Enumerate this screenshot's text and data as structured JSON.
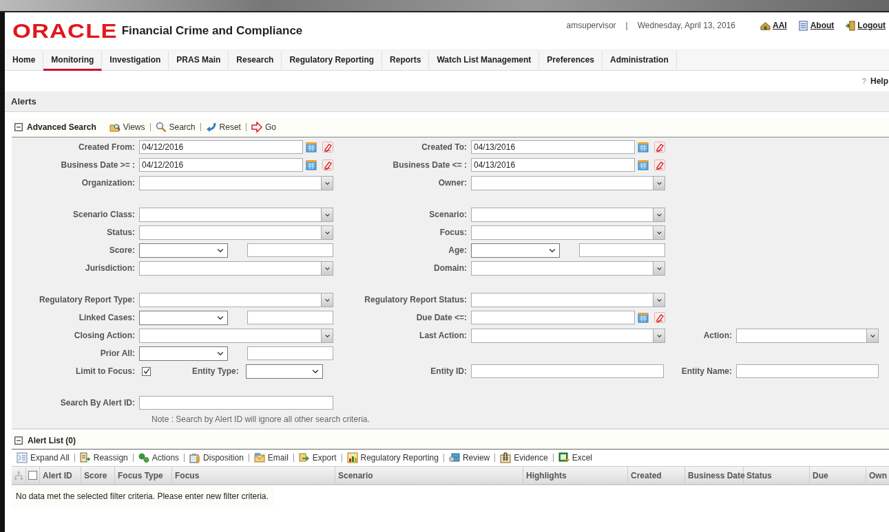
{
  "header": {
    "logo": "ORACLE",
    "app_title": "Financial Crime and Compliance",
    "user": "amsupervisor",
    "separator": "|",
    "date": "Wednesday, April 13, 2016",
    "links": [
      {
        "label": "AAI",
        "kind": "house"
      },
      {
        "label": "About",
        "kind": "document"
      },
      {
        "label": "Logout",
        "kind": "door"
      }
    ]
  },
  "nav": {
    "tabs": [
      {
        "label": "Home",
        "selected": false
      },
      {
        "label": "Monitoring",
        "selected": true
      },
      {
        "label": "Investigation",
        "selected": false
      },
      {
        "label": "PRAS Main",
        "selected": false
      },
      {
        "label": "Research",
        "selected": false
      },
      {
        "label": "Regulatory Reporting",
        "selected": false
      },
      {
        "label": "Reports",
        "selected": false
      },
      {
        "label": "Watch List Management",
        "selected": false
      },
      {
        "label": "Preferences",
        "selected": false
      },
      {
        "label": "Administration",
        "selected": false
      }
    ]
  },
  "help": {
    "icon": "?",
    "label": "Help"
  },
  "page_title": "Alerts",
  "advanced_search": {
    "expanded": true,
    "title": "Advanced Search",
    "toolbar": [
      {
        "label": "Views",
        "kind": "views"
      },
      {
        "label": "Search",
        "kind": "search"
      },
      {
        "label": "Reset",
        "kind": "reset"
      },
      {
        "label": "Go",
        "kind": "go"
      }
    ],
    "groups": [
      [
        [
          {
            "label": "Created From:",
            "kind": "date",
            "value": "04/12/2016"
          },
          {
            "label": "Created To:",
            "kind": "date",
            "value": "04/13/2016"
          }
        ],
        [
          {
            "label": "Business Date >= :",
            "kind": "date",
            "value": "04/12/2016"
          },
          {
            "label": "Business Date <= :",
            "kind": "date",
            "value": "04/13/2016"
          }
        ],
        [
          {
            "label": "Organization:",
            "kind": "combo"
          },
          {
            "label": "Owner:",
            "kind": "combo"
          }
        ]
      ],
      [
        [
          {
            "label": "Scenario Class:",
            "kind": "combo"
          },
          {
            "label": "Scenario:",
            "kind": "combo"
          }
        ],
        [
          {
            "label": "Status:",
            "kind": "combo"
          },
          {
            "label": "Focus:",
            "kind": "combo"
          }
        ],
        [
          {
            "label": "Score:",
            "kind": "select_text"
          },
          {
            "label": "Age:",
            "kind": "select_text"
          }
        ],
        [
          {
            "label": "Jurisdiction:",
            "kind": "combo"
          },
          {
            "label": "Domain:",
            "kind": "combo"
          }
        ]
      ],
      [
        [
          {
            "label": "Regulatory Report Type:",
            "kind": "combo"
          },
          {
            "label": "Regulatory Report Status:",
            "kind": "combo"
          }
        ],
        [
          {
            "label": "Linked Cases:",
            "kind": "select_text"
          },
          {
            "label": "Due Date <=:",
            "kind": "date"
          }
        ],
        [
          {
            "label": "Closing Action:",
            "kind": "combo"
          },
          {
            "label": "Last Action:",
            "kind": "combo"
          },
          {
            "label": "Action:",
            "kind": "combo"
          }
        ],
        [
          {
            "label": "Prior All:",
            "kind": "select_text"
          }
        ],
        [
          {
            "label": "Limit to Focus:",
            "kind": "check",
            "checked": true,
            "extra": {
              "label": "Entity Type:",
              "kind": "select"
            }
          },
          {
            "label": "Entity ID:",
            "kind": "text"
          },
          {
            "label": "Entity Name:",
            "kind": "text"
          }
        ]
      ],
      [
        [
          {
            "label": "Search By Alert ID:",
            "kind": "wide_text"
          }
        ]
      ]
    ],
    "note": "Note : Search by Alert ID will ignore all other search criteria."
  },
  "alert_list": {
    "expanded": true,
    "title": "Alert List (0)",
    "toolbar": [
      {
        "label": "Expand All",
        "kind": "expand"
      },
      {
        "label": "Reassign",
        "kind": "reassign"
      },
      {
        "label": "Actions",
        "kind": "actions"
      },
      {
        "label": "Disposition",
        "kind": "disposition"
      },
      {
        "label": "Email",
        "kind": "email"
      },
      {
        "label": "Export",
        "kind": "export"
      },
      {
        "label": "Regulatory Reporting",
        "kind": "reporting"
      },
      {
        "label": "Review",
        "kind": "review"
      },
      {
        "label": "Evidence",
        "kind": "evidence"
      },
      {
        "label": "Excel",
        "kind": "excel"
      }
    ],
    "select_all_checked": false,
    "columns": [
      "Alert ID",
      "Score",
      "Focus Type",
      "Focus",
      "Scenario",
      "Highlights",
      "Created",
      "Business Date",
      "Status",
      "Due",
      "Own"
    ],
    "empty_message": "No data met the selected filter criteria. Please enter new filter criteria."
  }
}
